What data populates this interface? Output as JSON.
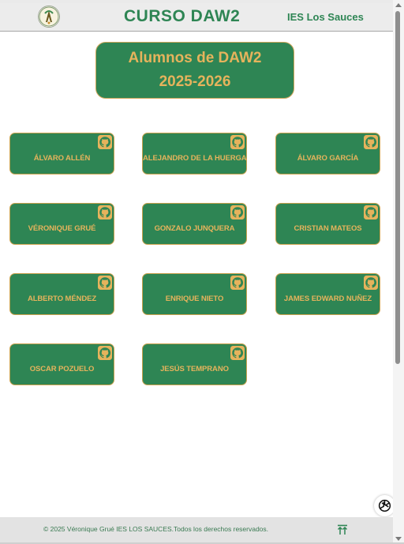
{
  "header": {
    "title": "CURSO DAW2",
    "school_link": "IES Los Sauces",
    "logo_icon": "school-crest-icon"
  },
  "hero": {
    "line1": "Alumnos de DAW2",
    "line2": "2025-2026"
  },
  "students": [
    {
      "name": "ÁLVARO ALLÉN",
      "icon": "github-icon"
    },
    {
      "name": "ALEJANDRO DE LA HUERGA",
      "icon": "github-icon"
    },
    {
      "name": "ÁLVARO GARCÍA",
      "icon": "github-icon"
    },
    {
      "name": "VÉRONIQUE GRUÉ",
      "icon": "github-icon"
    },
    {
      "name": "GONZALO JUNQUERA",
      "icon": "github-icon"
    },
    {
      "name": "CRISTIAN MATEOS",
      "icon": "github-icon"
    },
    {
      "name": "ALBERTO MÉNDEZ",
      "icon": "github-icon"
    },
    {
      "name": "ENRIQUE NIETO",
      "icon": "github-icon"
    },
    {
      "name": "JAMES EDWARD NUÑEZ",
      "icon": "github-icon"
    },
    {
      "name": "OSCAR POZUELO",
      "icon": "github-icon"
    },
    {
      "name": "JESÚS TEMPRANO",
      "icon": "github-icon"
    }
  ],
  "footer": {
    "copyright": "© 2025 Véronique Grué IES LOS SAUCES.Todos los derechos reservados.",
    "back_to_top_icon": "double-arrow-up-icon"
  },
  "floating": {
    "chat_icon": "chatgpt-icon"
  },
  "colors": {
    "brand_green": "#2e8554",
    "accent_gold": "#e6b35c",
    "card_border": "#c9a24e"
  }
}
